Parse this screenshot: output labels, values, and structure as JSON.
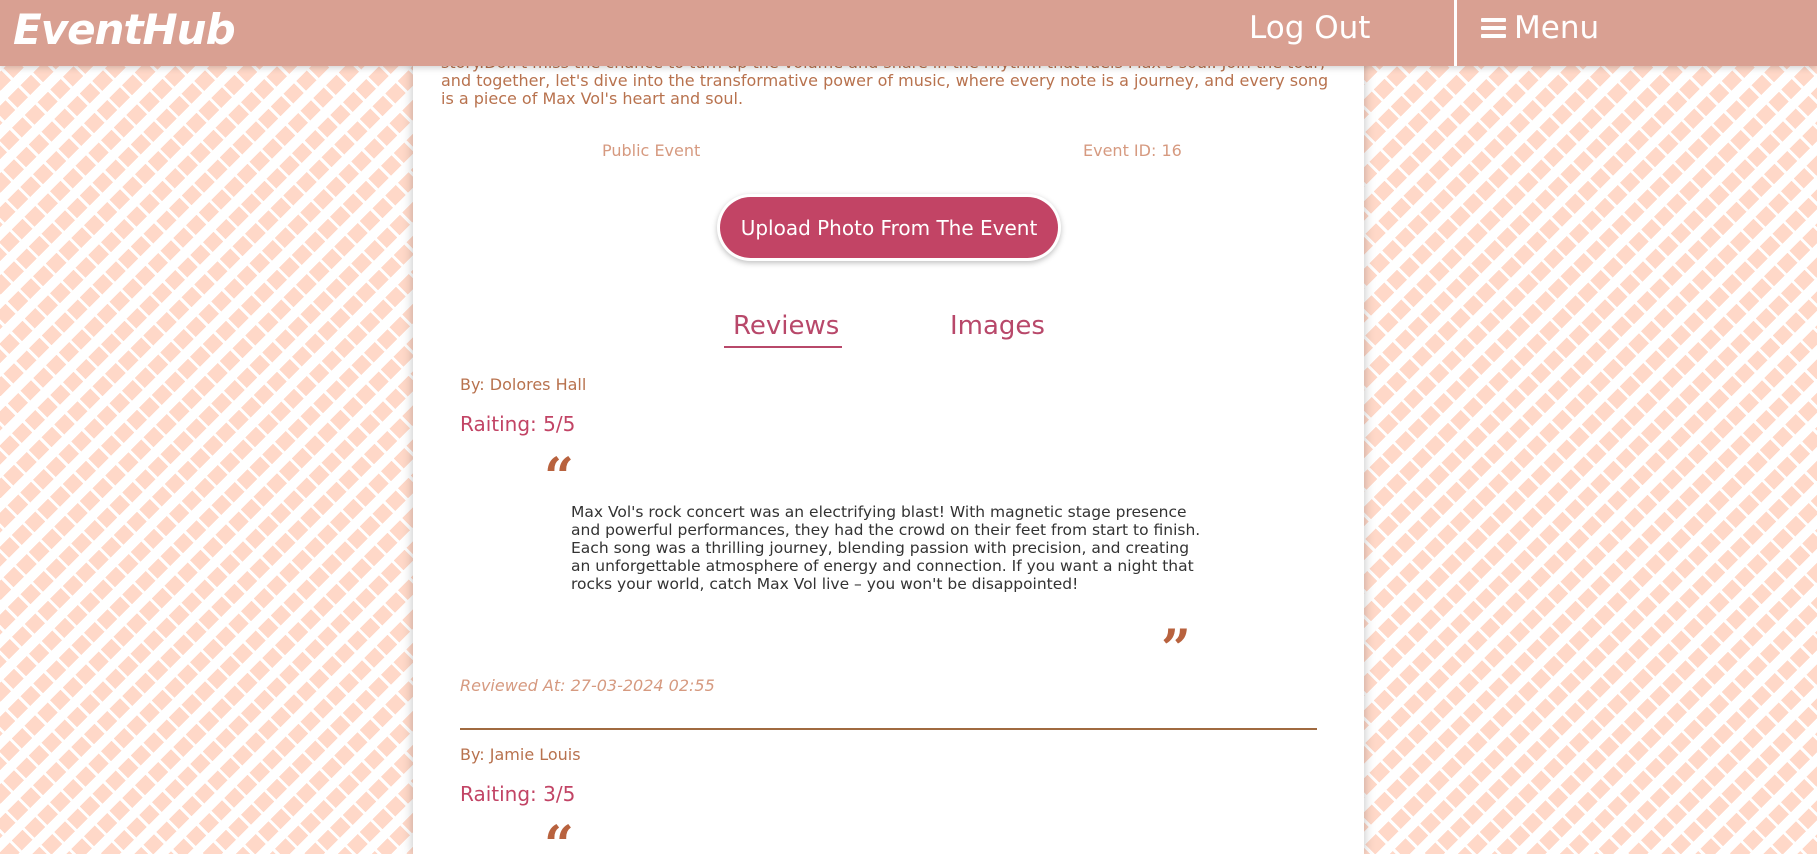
{
  "header": {
    "brand": "EventHub",
    "logout_label": "Log Out",
    "menu_label": "Menu"
  },
  "event": {
    "description_tail": "story.Don't miss the chance to turn up the volume and share in the rhythm that fuels Max's soul. Join the tour, and together, let's dive into the transformative power of music, where every note is a journey, and every song is a piece of Max Vol's heart and soul.",
    "visibility": "Public Event",
    "event_id": "Event ID: 16",
    "upload_label": "Upload Photo From The Event"
  },
  "tabs": {
    "reviews": "Reviews",
    "images": "Images",
    "active": "Reviews"
  },
  "reviews": [
    {
      "by": "By: Dolores Hall",
      "rating": "Raiting: 5/5",
      "text": "Max Vol's rock concert was an electrifying blast! With magnetic stage presence and powerful performances, they had the crowd on their feet from start to finish. Each song was a thrilling journey, blending passion with precision, and creating an unforgettable atmosphere of energy and connection. If you want a night that rocks your world, catch Max Vol live – you won't be disappointed!",
      "reviewed_at": "Reviewed At: 27-03-2024 02:55"
    },
    {
      "by": "By: Jamie Louis",
      "rating": "Raiting: 3/5"
    }
  ],
  "icons": {
    "menu": "hamburger-icon",
    "quote_open": "quote-open-icon",
    "quote_close": "quote-close-icon"
  },
  "colors": {
    "header": "#d9a092",
    "accent": "#c24465",
    "text_warm": "#b8724e",
    "pattern": "#ffd8c8"
  }
}
